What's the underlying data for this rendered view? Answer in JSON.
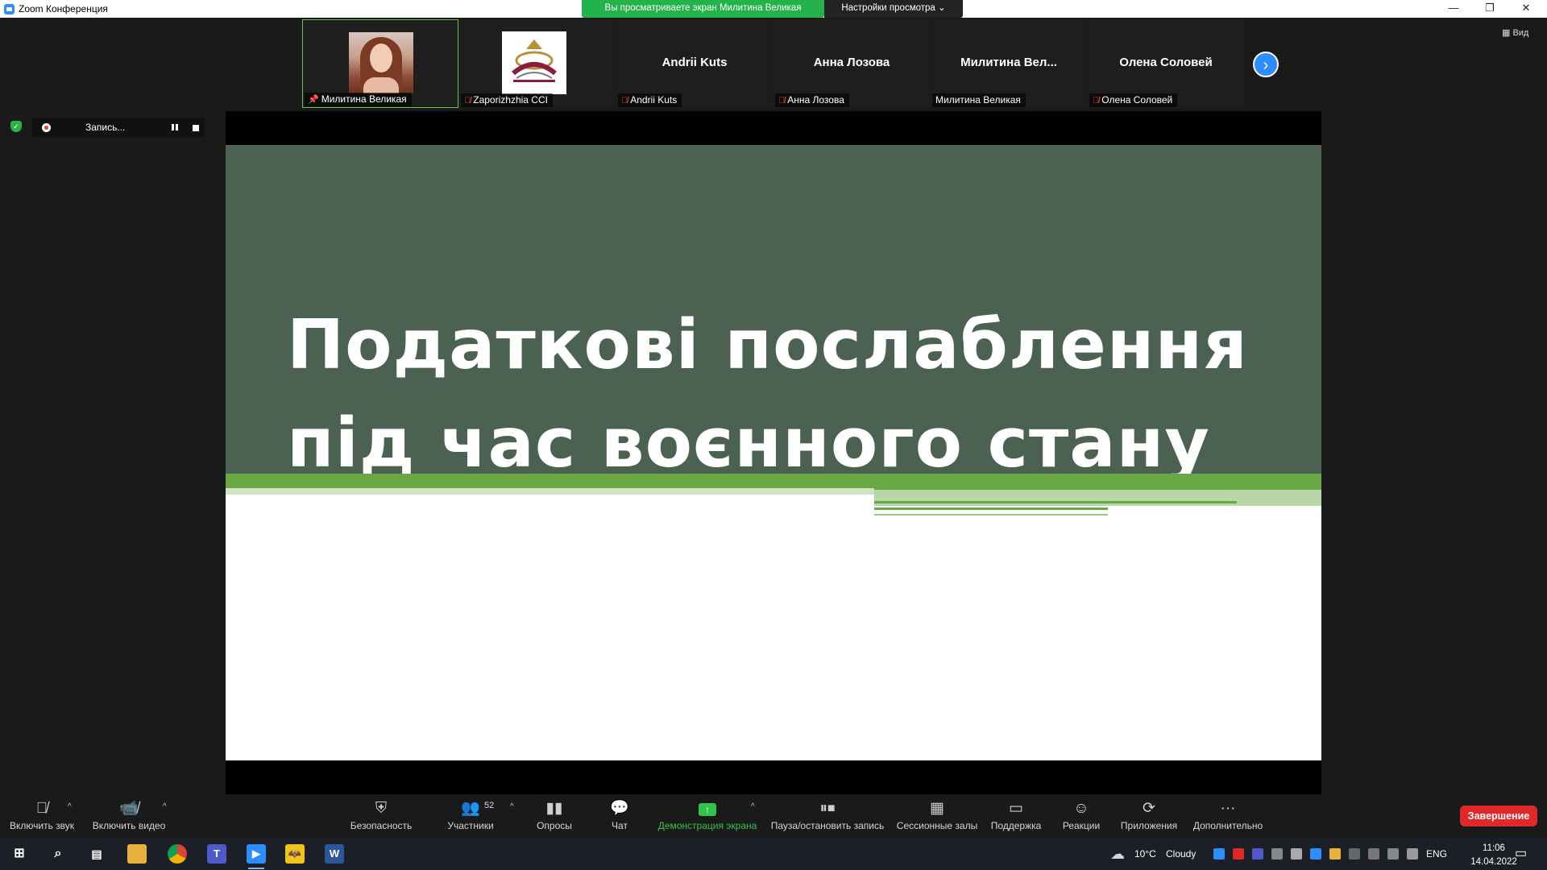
{
  "window": {
    "title": "Zoom Конференция",
    "banner": "Вы просматриваете экран Милитина Великая",
    "view_settings": "Настройки просмотра ⌄",
    "minimize": "—",
    "restore": "❐",
    "close": "✕"
  },
  "gallery": {
    "view_label": "▦ Вид",
    "tiles": [
      {
        "label": "Милитина Великая",
        "name": "",
        "muted": false,
        "pinned": true,
        "type": "photo"
      },
      {
        "label": "Zaporizhzhia CCI",
        "name": "",
        "muted": true,
        "type": "logo"
      },
      {
        "label": "Andrii Kuts",
        "name": "Andrii Kuts",
        "muted": true
      },
      {
        "label": "Анна Лозова",
        "name": "Анна Лозова",
        "muted": true
      },
      {
        "label": "Милитина Великая",
        "name": "Милитина  Вел...",
        "muted": false
      },
      {
        "label": "Олена Соловей",
        "name": "Олена Соловей",
        "muted": true
      }
    ],
    "next": "›"
  },
  "recording": {
    "status": "Запись..."
  },
  "slide": {
    "title": "Податкові послаблення під час воєнного стану",
    "colors": {
      "top": "#4b6152",
      "accent": "#6aa845"
    }
  },
  "toolbar": {
    "audio": "Включить звук",
    "video": "Включить видео",
    "security": "Безопасность",
    "participants": "Участники",
    "participants_count": "52",
    "polls": "Опросы",
    "chat": "Чат",
    "share": "Демонстрация экрана",
    "record": "Пауза/остановить запись",
    "breakout": "Сессионные залы",
    "support": "Поддержка",
    "reactions": "Реакции",
    "apps": "Приложения",
    "more": "Дополнительно",
    "end": "Завершение"
  },
  "taskbar": {
    "weather_temp": "10°C",
    "weather_text": "Cloudy",
    "lang": "ENG",
    "time": "11:06",
    "date": "14.04.2022"
  }
}
